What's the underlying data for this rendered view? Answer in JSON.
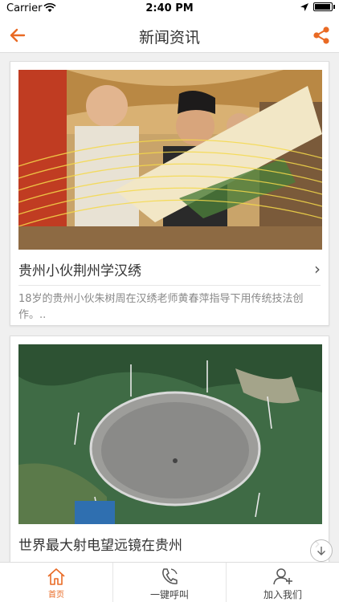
{
  "status_bar": {
    "carrier": "Carrier",
    "time": "2:40 PM",
    "battery_level": 1.0
  },
  "nav": {
    "title": "新闻资讯",
    "back_icon": "back-arrow-icon",
    "share_icon": "share-icon"
  },
  "articles": [
    {
      "headline": "贵州小伙荆州学汉绣",
      "summary": "18岁的贵州小伙朱树周在汉绣老师黄春萍指导下用传统技法创作。..",
      "image": "embroidery-photo"
    },
    {
      "headline": "世界最大射电望远镜在贵州",
      "summary": "",
      "image": "radio-telescope-photo"
    }
  ],
  "tabs": [
    {
      "label": "首页",
      "icon": "home-icon",
      "active": true
    },
    {
      "label": "一键呼叫",
      "icon": "phone-icon",
      "active": false
    },
    {
      "label": "加入我们",
      "icon": "add-user-icon",
      "active": false
    }
  ],
  "colors": {
    "accent": "#e96a24",
    "text": "#333333",
    "muted": "#888888"
  }
}
